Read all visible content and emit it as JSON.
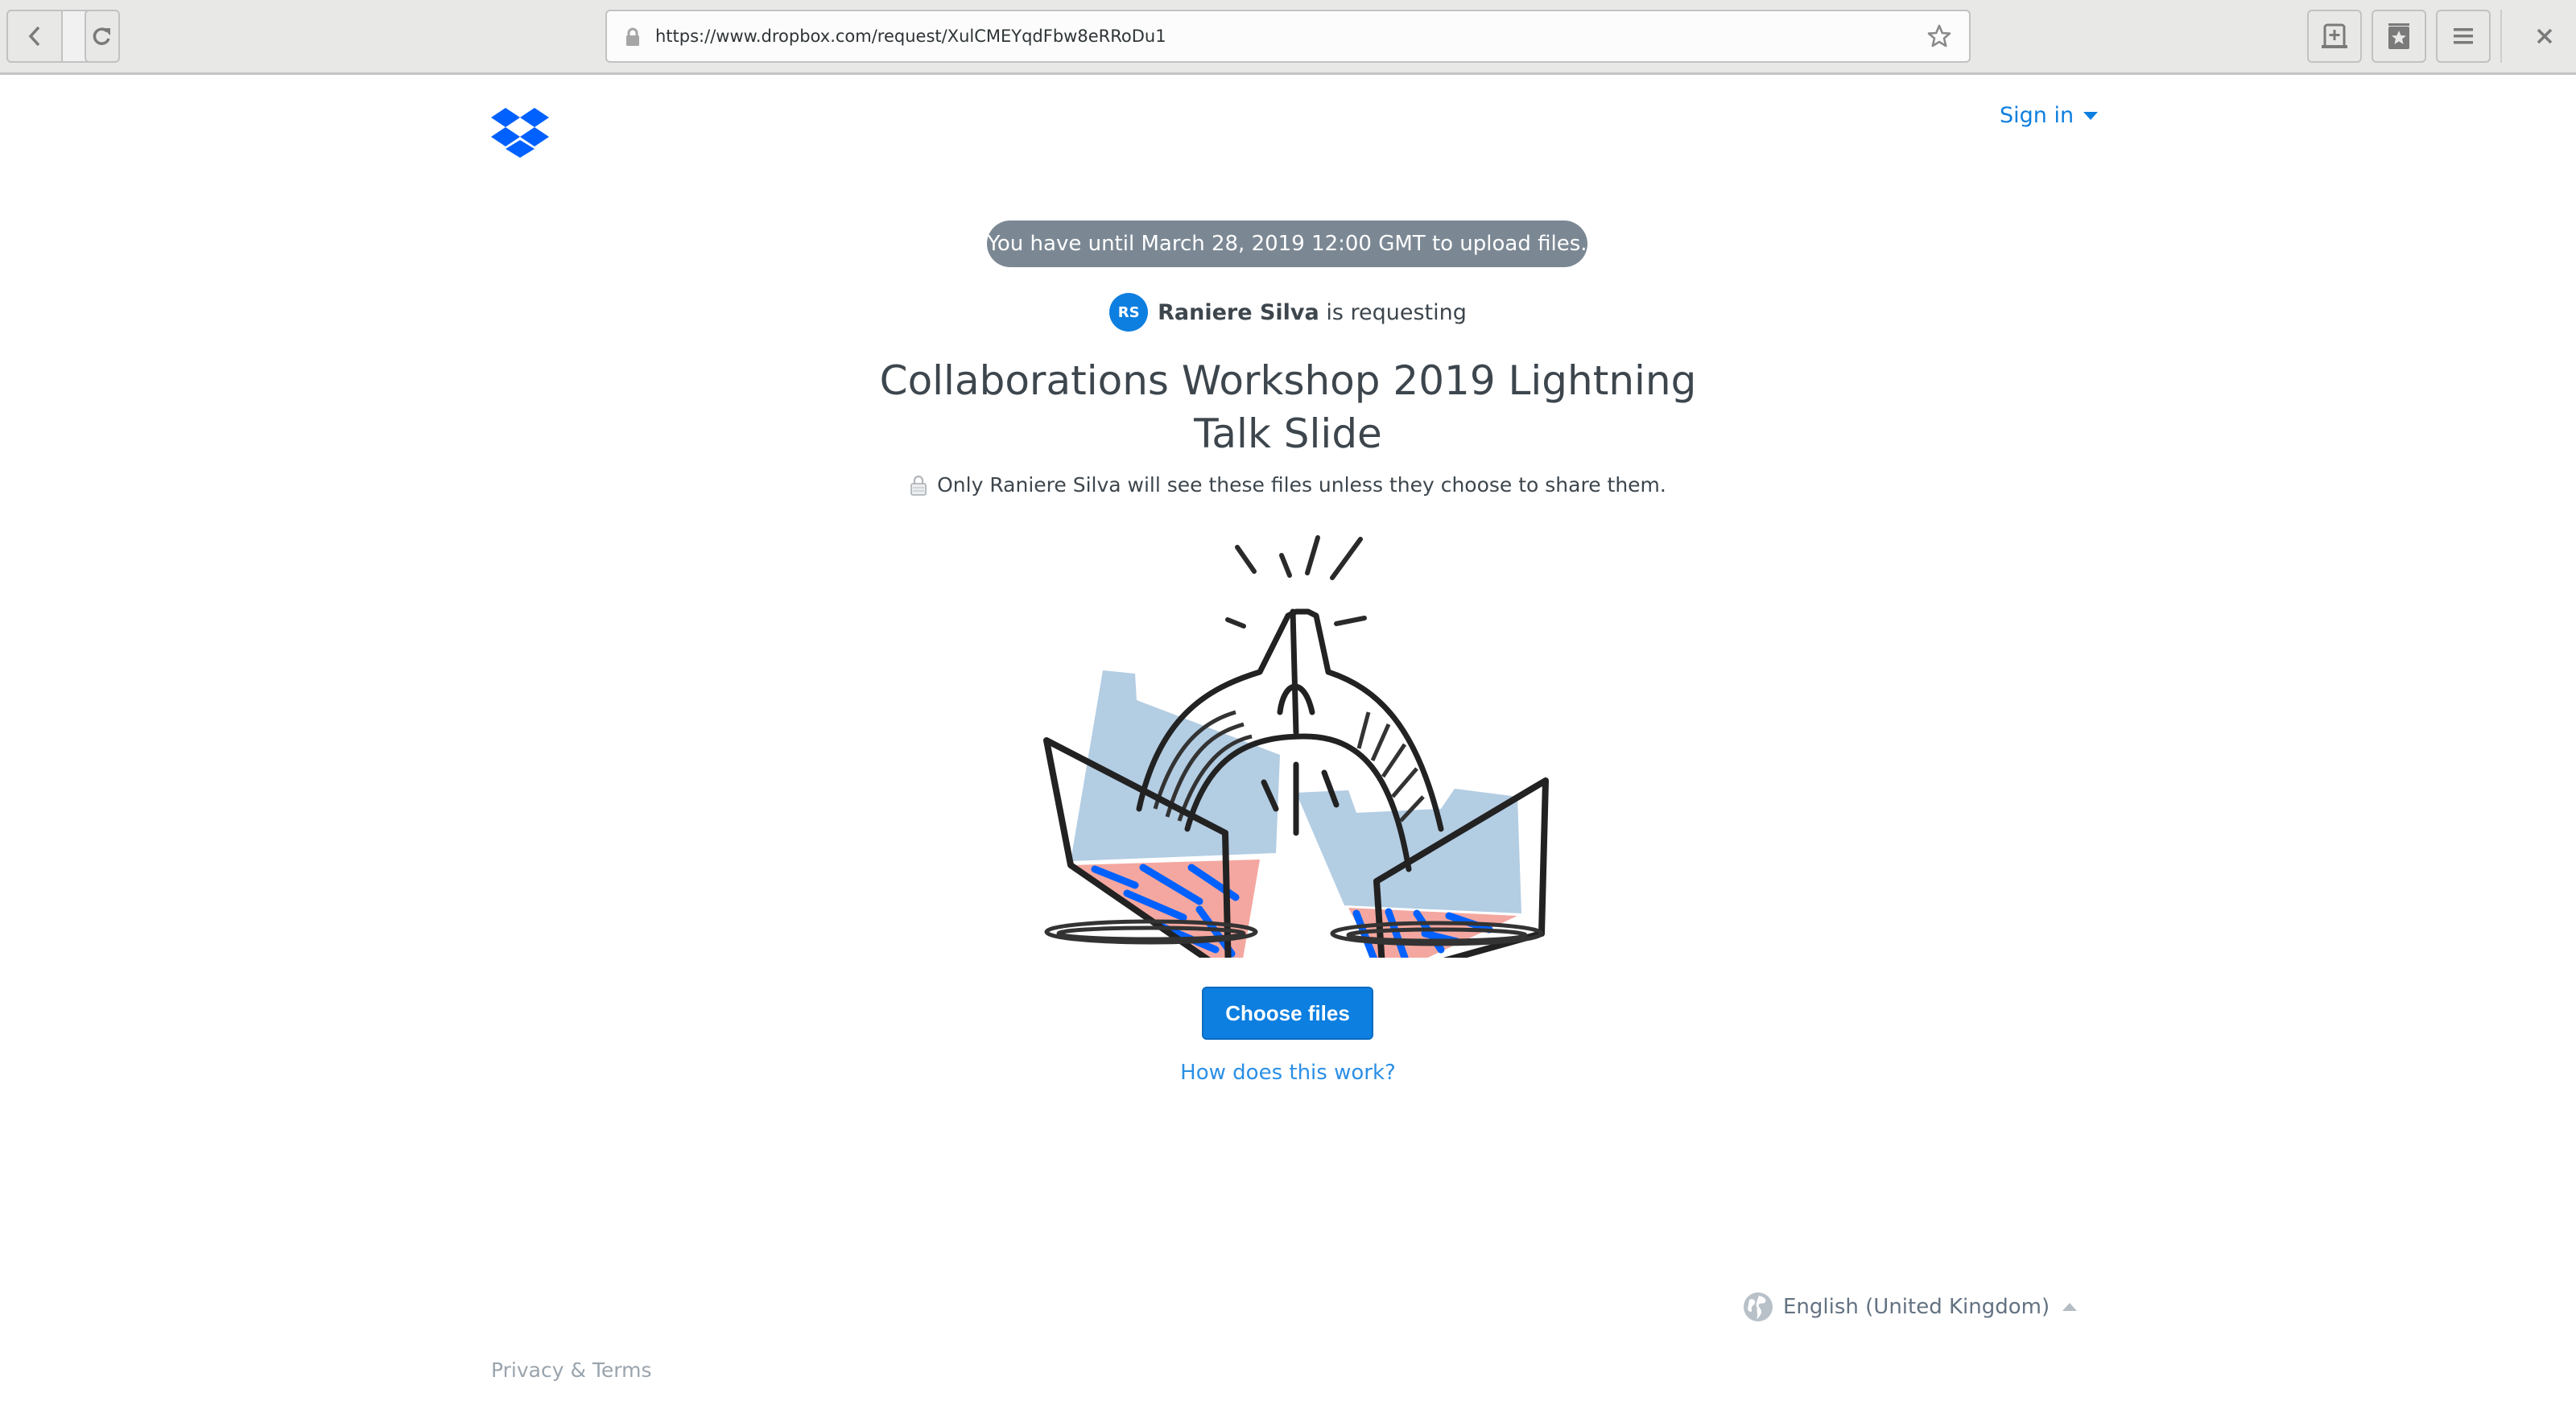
{
  "browser": {
    "url": "https://www.dropbox.com/request/XulCMEYqdFbw8eRRoDu1",
    "icons": {
      "back": "chevron-left-icon",
      "forward": "chevron-right-icon",
      "reload": "reload-icon",
      "secure": "lock-icon",
      "bookmark": "star-outline-icon",
      "new_tab": "new-tab-icon",
      "bookmarks_menu": "bookmarks-icon",
      "menu": "hamburger-icon",
      "close": "close-icon"
    }
  },
  "header": {
    "logo": "dropbox-logo",
    "sign_in_label": "Sign in"
  },
  "request": {
    "deadline_text": "You have until March 28, 2019 12:00 GMT to upload files.",
    "requester_initials": "RS",
    "requester_name": "Raniere Silva",
    "requesting_suffix": "is requesting",
    "title": "Collaborations Workshop 2019 Lightning Talk Slide",
    "privacy_note": "Only Raniere Silva will see these files unless they choose to share them.",
    "illustration": "high-five-folders-illustration",
    "choose_files_label": "Choose files",
    "how_it_works_label": "How does this work?"
  },
  "footer": {
    "language_label": "English (United Kingdom)",
    "privacy_terms_label": "Privacy & Terms"
  },
  "colors": {
    "accent": "#0d7fe0",
    "deadline_pill": "#7b8894",
    "text": "#3d464d",
    "link": "#2b8fe6",
    "footer_text": "#9aa4ad"
  }
}
